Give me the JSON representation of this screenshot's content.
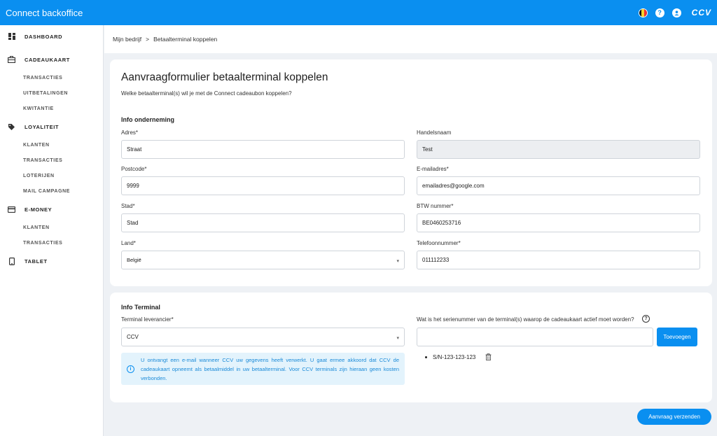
{
  "app": {
    "title": "Connect backoffice",
    "brand": "CCV"
  },
  "topbar": {
    "icons": [
      "belgium-flag-icon",
      "help-icon",
      "account-icon"
    ]
  },
  "sidebar": {
    "sections": [
      {
        "label": "DASHBOARD",
        "icon": "dashboard-icon",
        "items": []
      },
      {
        "label": "CADEAUKAART",
        "icon": "giftcard-icon",
        "items": [
          "TRANSACTIES",
          "UITBETALINGEN",
          "KWITANTIE"
        ]
      },
      {
        "label": "LOYALITEIT",
        "icon": "tag-icon",
        "items": [
          "KLANTEN",
          "TRANSACTIES",
          "LOTERIJEN",
          "MAIL CAMPAGNE"
        ]
      },
      {
        "label": "E-MONEY",
        "icon": "card-icon",
        "items": [
          "KLANTEN",
          "TRANSACTIES"
        ]
      },
      {
        "label": "TABLET",
        "icon": "tablet-icon",
        "items": []
      }
    ]
  },
  "breadcrumb": {
    "parent": "Mijn bedrijf",
    "separator": ">",
    "current": "Betaalterminal koppelen"
  },
  "form": {
    "title": "Aanvraagformulier betaalterminal koppelen",
    "subtitle": "Welke betaalterminal(s) wil je met de Connect cadeaubon koppelen?",
    "company_section": "Info onderneming",
    "fields": {
      "adres": {
        "label": "Adres*",
        "value": "Straat"
      },
      "handelsnaam": {
        "label": "Handelsnaam",
        "value": "Test"
      },
      "postcode": {
        "label": "Postcode*",
        "value": "9999"
      },
      "email": {
        "label": "E-mailadres*",
        "value": "emailadres@google.com"
      },
      "stad": {
        "label": "Stad*",
        "value": "Stad"
      },
      "btw": {
        "label": "BTW nummer*",
        "value": "BE0460253716"
      },
      "land": {
        "label": "Land*",
        "value": "België"
      },
      "telefoon": {
        "label": "Telefoonnummer*",
        "value": "011112233"
      }
    },
    "terminal_section": "Info Terminal",
    "supplier": {
      "label": "Terminal leverancier*",
      "value": "CCV"
    },
    "info_text": "U ontvangt een e-mail wanneer CCV uw gegevens heeft verwerkt. U gaat ermee akkoord dat CCV de cadeaukaart opneemt als betaalmiddel in uw betaalterminal. Voor CCV terminals zijn hieraan geen kosten verbonden.",
    "serial": {
      "label": "Wat is het serienummer van de terminal(s) waarop de cadeaukaart actief moet worden?",
      "value": "",
      "add_button": "Toevoegen",
      "items": [
        "S/N-123-123-123"
      ]
    },
    "submit_button": "Aanvraag verzenden"
  },
  "colors": {
    "primary": "#0a8ff0",
    "background": "#eef1f5",
    "info_bg": "#e3f3fc"
  }
}
